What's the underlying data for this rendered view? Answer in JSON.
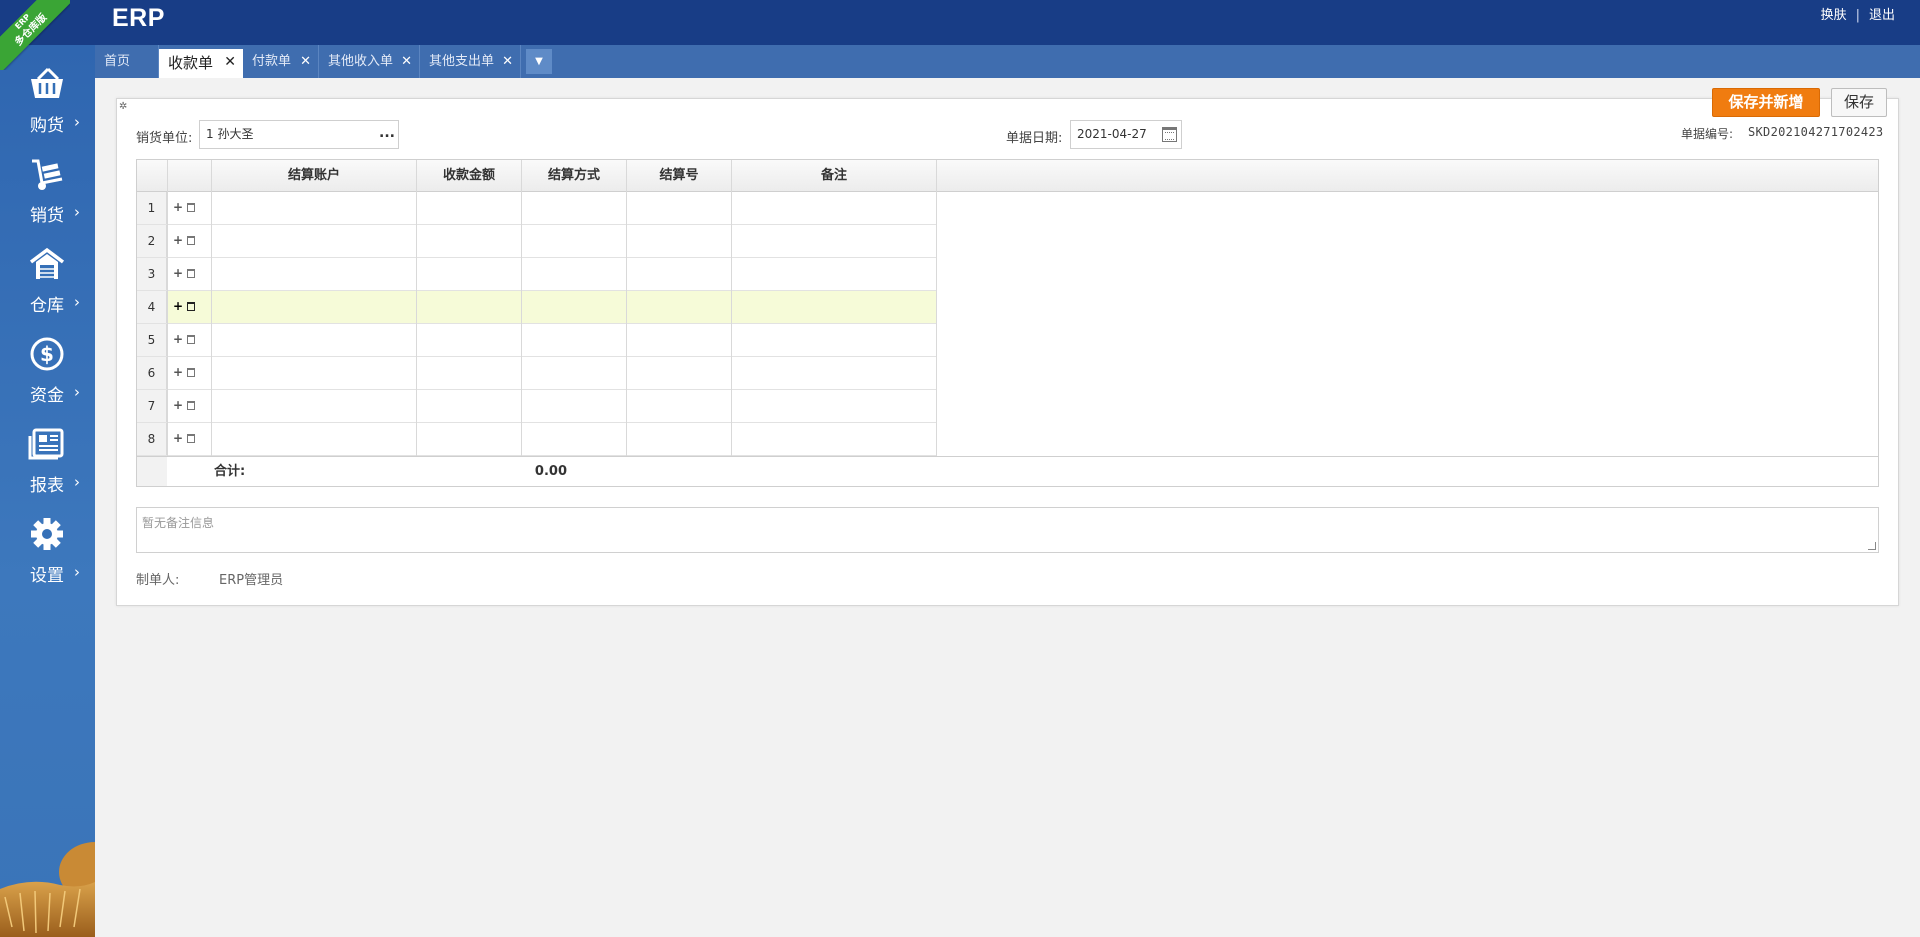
{
  "header": {
    "brand": "ERP",
    "ribbon_top": "ERP",
    "ribbon_main": "多仓库版",
    "links": [
      "换肤",
      "退出"
    ],
    "separator": "|"
  },
  "sidebar": {
    "items": [
      {
        "label": "购货",
        "icon": "basket-icon"
      },
      {
        "label": "销货",
        "icon": "hand-truck-icon"
      },
      {
        "label": "仓库",
        "icon": "warehouse-icon"
      },
      {
        "label": "资金",
        "icon": "dollar-icon"
      },
      {
        "label": "报表",
        "icon": "report-icon"
      },
      {
        "label": "设置",
        "icon": "gear-icon"
      }
    ],
    "chevron": "›"
  },
  "tabs": [
    {
      "label": "首页",
      "closable": false
    },
    {
      "label": "收款单",
      "closable": true,
      "active": true
    },
    {
      "label": "付款单",
      "closable": true
    },
    {
      "label": "其他收入单",
      "closable": true
    },
    {
      "label": "其他支出单",
      "closable": true
    }
  ],
  "tab_close": "✕",
  "tab_more": "▼",
  "toolbar": {
    "save_new_label": "保存并新增",
    "save_label": "保存"
  },
  "form": {
    "customer_label": "销货单位:",
    "customer_value": "1 孙大圣",
    "customer_picker": "...",
    "date_label": "单据日期:",
    "date_value": "2021-04-27",
    "docno_label": "单据编号:",
    "docno_value": "SKD202104271702423"
  },
  "grid": {
    "columns": [
      "结算账户",
      "收款金额",
      "结算方式",
      "结算号",
      "备注"
    ],
    "rows": [
      "1",
      "2",
      "3",
      "4",
      "5",
      "6",
      "7",
      "8"
    ],
    "highlighted_row": 4,
    "total_label": "合计:",
    "total_amount": "0.00"
  },
  "remark": {
    "placeholder": "暂无备注信息"
  },
  "maker": {
    "label": "制单人:",
    "value": "ERP管理员"
  },
  "colors": {
    "topbar": "#183d86",
    "sidebar": "#3570b7",
    "tabbar": "#3f6daf",
    "accent_orange": "#f07c10",
    "ribbon_green": "#3aa535",
    "row_highlight": "#f6fbd8"
  }
}
